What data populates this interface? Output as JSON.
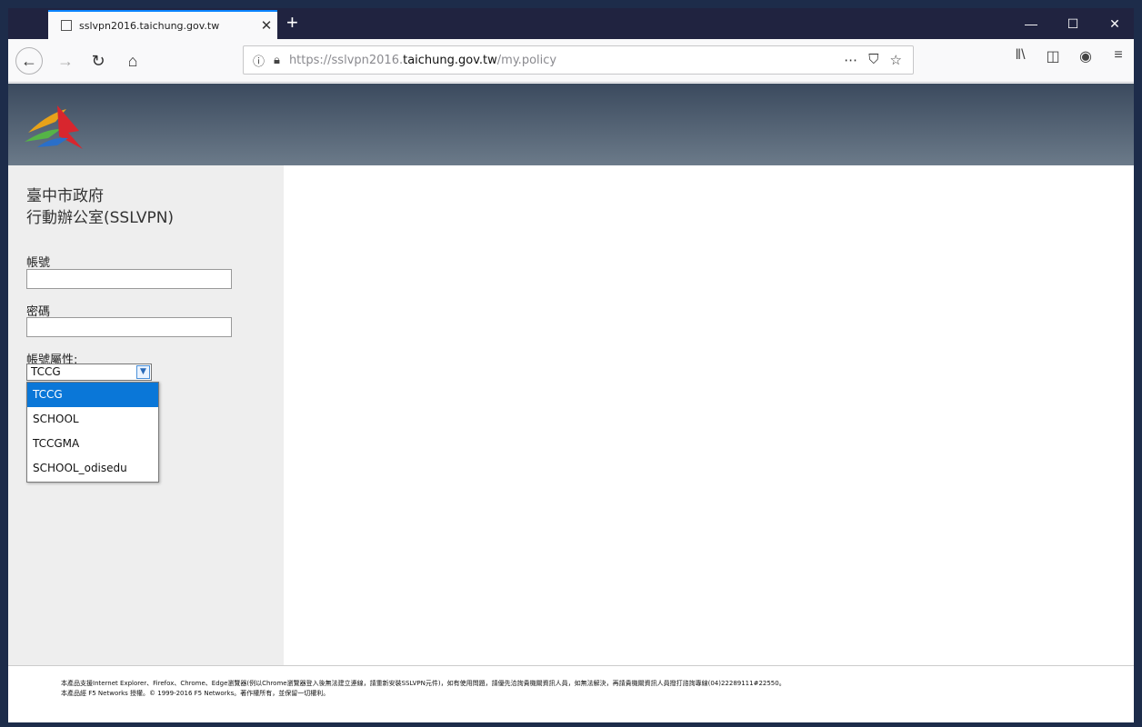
{
  "browser": {
    "tab_title": "sslvpn2016.taichung.gov.tw",
    "tab_close": "✕",
    "new_tab": "+",
    "url_prefix": "https://sslvpn2016.",
    "url_domain": "taichung.gov.tw",
    "url_path": "/my.policy",
    "window_controls": {
      "minimize": "—",
      "maximize": "☐",
      "close": "✕"
    }
  },
  "page": {
    "org_name": "臺中市政府",
    "office_name": "行動辦公室(SSLVPN)",
    "username_label": "帳號",
    "password_label": "密碼",
    "account_type_label": "帳號屬性:",
    "account_type_selected": "TCCG",
    "account_type_options": [
      "TCCG",
      "SCHOOL",
      "TCCGMA",
      "SCHOOL_odisedu"
    ],
    "footer_line1": "本產品支援Internet Explorer、Firefox、Chrome、Edge瀏覽器(例以Chrome瀏覽器登入後無法建立連線，請重新安裝SSLVPN元件)，如有使用問題，請優先洽詢貴機關資訊人員，如無法解決，再請貴機關資訊人員撥打諮詢專線(04)22289111#22550。",
    "footer_line2": "本產品經 F5 Networks 授權。© 1999-2016 F5 Networks。著作權所有，並保留一切權利。"
  },
  "colors": {
    "titlebar": "#202340",
    "tab_accent": "#0a84ff",
    "dropdown_selected": "#0a77d8",
    "sidebar_bg": "#eeeeee"
  }
}
